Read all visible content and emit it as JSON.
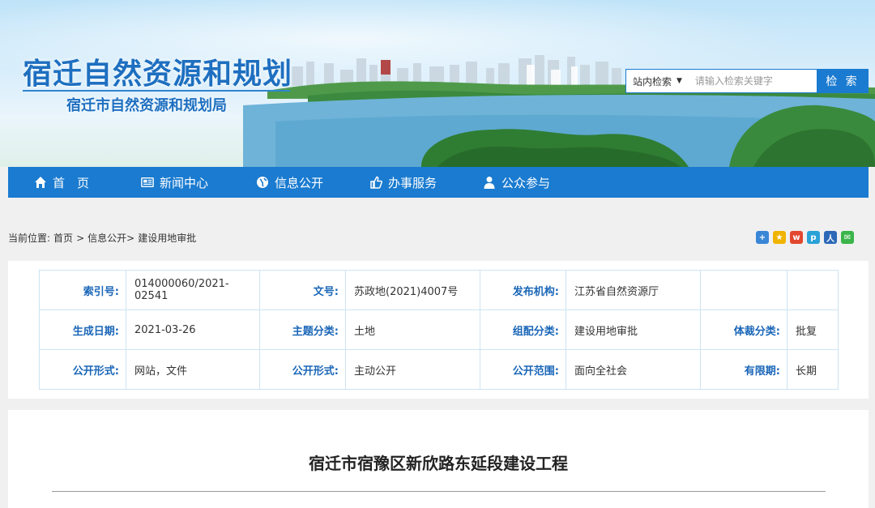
{
  "header": {
    "title": "宿迁自然资源和规划",
    "subtitle": "宿迁市自然资源和规划局"
  },
  "search": {
    "scope": "站内检索",
    "placeholder": "请输入检索关键字",
    "button": "检 索"
  },
  "nav": [
    {
      "label": "首　页",
      "icon": "home-icon"
    },
    {
      "label": "新闻中心",
      "icon": "newspaper-icon"
    },
    {
      "label": "信息公开",
      "icon": "globe-icon"
    },
    {
      "label": "办事服务",
      "icon": "thumbs-up-icon"
    },
    {
      "label": "公众参与",
      "icon": "user-icon"
    }
  ],
  "breadcrumb": {
    "prefix": "当前位置:",
    "items": [
      "首页",
      ">",
      "信息公开>",
      "建设用地审批"
    ]
  },
  "share_icons": [
    "plus-share-icon",
    "qzone-icon",
    "weibo-icon",
    "tencent-weibo-icon",
    "renren-icon",
    "wechat-icon"
  ],
  "meta": {
    "rows": [
      [
        {
          "k": "索引号:",
          "v": "014000060/2021-02541"
        },
        {
          "k": "文号:",
          "v": "苏政地(2021)4007号"
        },
        {
          "k": "发布机构:",
          "v": "江苏省自然资源厅"
        },
        {
          "k": "",
          "v": ""
        }
      ],
      [
        {
          "k": "生成日期:",
          "v": "2021-03-26"
        },
        {
          "k": "主题分类:",
          "v": "土地"
        },
        {
          "k": "组配分类:",
          "v": "建设用地审批"
        },
        {
          "k": "体裁分类:",
          "v": "批复"
        }
      ],
      [
        {
          "k": "公开形式:",
          "v": "网站，文件"
        },
        {
          "k": "公开形式:",
          "v": "主动公开"
        },
        {
          "k": "公开范围:",
          "v": "面向全社会"
        },
        {
          "k": "有限期:",
          "v": "长期"
        }
      ]
    ]
  },
  "article": {
    "title": "宿迁市宿豫区新欣路东延段建设工程"
  },
  "colors": {
    "primary": "#1a7bd0",
    "label": "#1a66b8",
    "border": "#cde4f2"
  }
}
